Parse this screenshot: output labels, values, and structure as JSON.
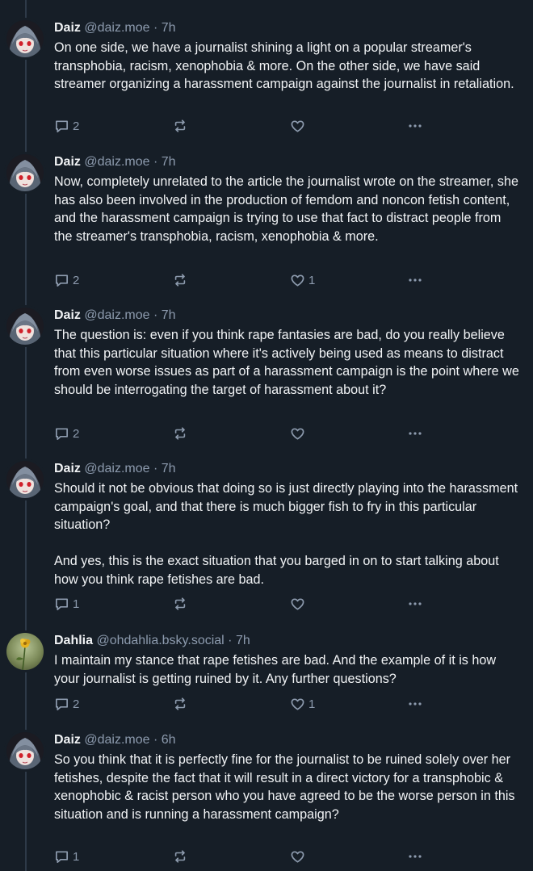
{
  "posts": [
    {
      "author": "Daiz",
      "handle": "@daiz.moe",
      "time": "7h",
      "text": "On one side, we have a journalist shining a light on a popular streamer's transphobia, racism, xenophobia & more. On the other side, we have said streamer organizing a harassment campaign against the journalist in retaliation.",
      "replies": "2",
      "reposts": "",
      "likes": ""
    },
    {
      "author": "Daiz",
      "handle": "@daiz.moe",
      "time": "7h",
      "text": "Now, completely unrelated to the article the journalist wrote on the streamer, she has also been involved in the production of femdom and noncon fetish content, and the harassment campaign is trying to use that fact to distract people from the streamer's transphobia, racism, xenophobia & more.",
      "replies": "2",
      "reposts": "",
      "likes": "1"
    },
    {
      "author": "Daiz",
      "handle": "@daiz.moe",
      "time": "7h",
      "text": "The question is: even if you think rape fantasies are bad, do you really believe that this particular situation where it's actively being used as means to distract from even worse issues as part of a harassment campaign is the point where we should be interrogating the target of harassment about it?",
      "replies": "2",
      "reposts": "",
      "likes": ""
    },
    {
      "author": "Daiz",
      "handle": "@daiz.moe",
      "time": "7h",
      "text": "Should it not be obvious that doing so is just directly playing into the harassment campaign's goal, and that there is much bigger fish to fry in this particular situation?\n\nAnd yes, this is the exact situation that you barged in on to start talking about how you think rape fetishes are bad.",
      "replies": "1",
      "reposts": "",
      "likes": ""
    },
    {
      "author": "Dahlia",
      "handle": "@ohdahlia.bsky.social",
      "time": "7h",
      "text": "I maintain my stance that rape fetishes are bad. And the example of it is how your journalist is getting ruined by it. Any further questions?",
      "replies": "2",
      "reposts": "",
      "likes": "1"
    },
    {
      "author": "Daiz",
      "handle": "@daiz.moe",
      "time": "6h",
      "text": "So you think that it is perfectly fine for the journalist to be ruined solely over her fetishes, despite the fact that it will result in a direct victory for a transphobic & xenophobic & racist person who you have agreed to be the worse person in this situation and is running a harassment campaign?",
      "replies": "1",
      "reposts": "",
      "likes": ""
    }
  ],
  "separator": "·",
  "colors": {
    "background": "#161e27",
    "text": "#f1f3f5",
    "muted": "#8d9bae",
    "thread_line": "#2e3a48"
  },
  "icons": {
    "reply": "reply-icon",
    "repost": "repost-icon",
    "like": "heart-icon",
    "more": "more-dots-icon"
  }
}
